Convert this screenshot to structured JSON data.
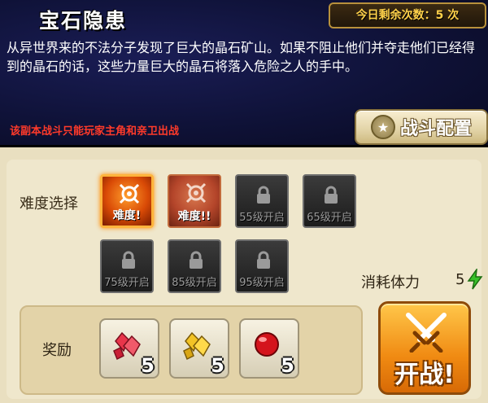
{
  "header": {
    "title": "宝石隐患",
    "daily_count": "今日剩余次数：5 次",
    "description": "从异世界来的不法分子发现了巨大的晶石矿山。如果不阻止他们并夺走他们已经得到的晶石的话，这些力量巨大的晶石将落入危险之人的手中。",
    "warning": "该副本战斗只能玩家主角和亲卫出战",
    "battle_config_label": "战斗配置"
  },
  "difficulty": {
    "label": "难度选择",
    "options": [
      {
        "label": "难度!",
        "state": "selected",
        "icon": "target-icon"
      },
      {
        "label": "难度!!",
        "state": "available",
        "icon": "target-icon"
      },
      {
        "label": "55级开启",
        "state": "locked",
        "icon": "lock-icon"
      },
      {
        "label": "65级开启",
        "state": "locked",
        "icon": "lock-icon"
      },
      {
        "label": "75级开启",
        "state": "locked",
        "icon": "lock-icon"
      },
      {
        "label": "85级开启",
        "state": "locked",
        "icon": "lock-icon"
      },
      {
        "label": "95级开启",
        "state": "locked",
        "icon": "lock-icon"
      }
    ]
  },
  "stamina": {
    "label": "消耗体力",
    "value": "5",
    "icon": "lightning-bolt-icon"
  },
  "rewards": {
    "label": "奖励",
    "items": [
      {
        "icon": "red-crystal-icon",
        "count": "5"
      },
      {
        "icon": "gold-crystal-icon",
        "count": "5"
      },
      {
        "icon": "red-gem-orb-icon",
        "count": "5"
      }
    ]
  },
  "fight_button": {
    "label": "开战!",
    "icon": "crossed-swords-icon"
  },
  "colors": {
    "header_bg": "#0f1238",
    "warning_text": "#ff3a2a",
    "count_text": "#ffd14a",
    "fight_button": "#f08a12",
    "panel_bg": "#efe7cc"
  }
}
